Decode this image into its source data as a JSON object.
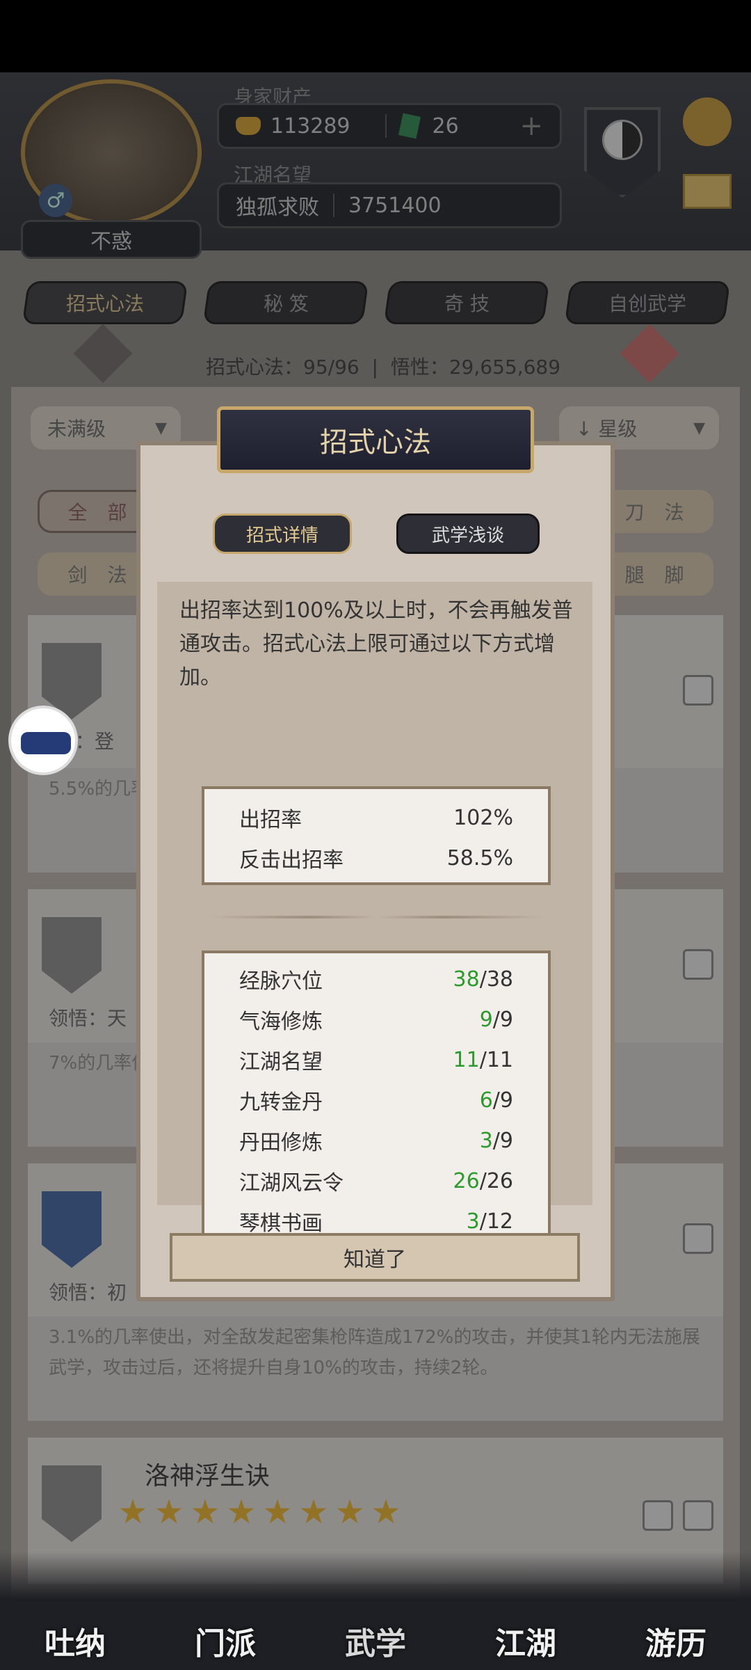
{
  "header": {
    "wealth_label": "身家财产",
    "gold": "113289",
    "jade": "26",
    "plus": "+",
    "reputation_label": "江湖名望",
    "title": "独孤求败",
    "reputation_value": "3751400",
    "age_label": "不惑",
    "gender_symbol": "♂"
  },
  "tabs": [
    {
      "label": "招式心法"
    },
    {
      "label": "秘 笈"
    },
    {
      "label": "奇 技"
    },
    {
      "label": "自创武学"
    }
  ],
  "stats": {
    "text": "招式心法：95/96  |  悟性：29,655,689"
  },
  "filters": {
    "left": "未满级",
    "right": "↓ 星级"
  },
  "categories": {
    "all": "全 部",
    "sword": "剑 法",
    "blade": "刀 法",
    "leg": "腿 脚"
  },
  "cards": [
    {
      "lead_label": "悟：登",
      "desc": "5.5%的几率使出，反击过后使出，反击造成身4350点...                   增加自"
    },
    {
      "lead_label": "领悟：天",
      "desc": "7%的几率使出，                                   反击对手造成2                                  轮。"
    },
    {
      "lead_label": "领悟：初",
      "desc": "3.1%的几率使出，对全敌发起密集枪阵造成172%的攻击，并使其1轮内无法施展武学，攻击过后，还将提升自身10%的攻击，持续2轮。"
    },
    {
      "name": "洛神浮生诀",
      "stars": 8
    }
  ],
  "modal": {
    "title": "招式心法",
    "tab_detail": "招式详情",
    "tab_talk": "武学浅谈",
    "description": "出招率达到100%及以上时，不会再触发普通攻击。招式心法上限可通过以下方式增加。",
    "rates": [
      {
        "label": "出招率",
        "value": "102%"
      },
      {
        "label": "反击出招率",
        "value": "58.5%"
      }
    ],
    "sources": [
      {
        "label": "经脉穴位",
        "current": "38",
        "max": "/38"
      },
      {
        "label": "气海修炼",
        "current": "9",
        "max": "/9"
      },
      {
        "label": "江湖名望",
        "current": "11",
        "max": "/11"
      },
      {
        "label": "九转金丹",
        "current": "6",
        "max": "/9"
      },
      {
        "label": "丹田修炼",
        "current": "3",
        "max": "/9"
      },
      {
        "label": "江湖风云令",
        "current": "26",
        "max": "/26"
      },
      {
        "label": "琴棋书画",
        "current": "3",
        "max": "/12"
      }
    ],
    "confirm": "知道了"
  },
  "bottom_nav": [
    {
      "label": "吐纳"
    },
    {
      "label": "门派"
    },
    {
      "label": "武学"
    },
    {
      "label": "江湖"
    },
    {
      "label": "游历"
    }
  ],
  "colors": {
    "accent_gold": "#c7a86a",
    "green_value": "#2c9a2c",
    "modal_bg": "#d0c6bb"
  },
  "icons": [
    "gold-ingot-icon",
    "jade-icon",
    "yin-yang-icon",
    "gear-icon",
    "mail-icon",
    "eye-icon",
    "overlay-float-icon"
  ]
}
